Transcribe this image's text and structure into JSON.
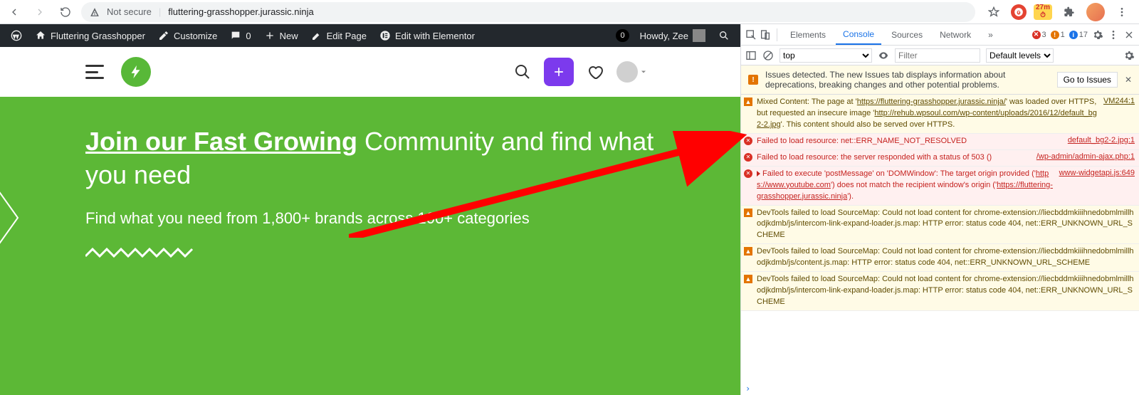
{
  "chrome": {
    "not_secure": "Not secure",
    "url": "fluttering-grasshopper.jurassic.ninja",
    "ext_badge": "27m"
  },
  "wp": {
    "site_name": "Fluttering Grasshopper",
    "customize": "Customize",
    "comments": "0",
    "new": "New",
    "edit_page": "Edit Page",
    "elementor": "Edit with Elementor",
    "notif_count": "0",
    "howdy": "Howdy, Zee"
  },
  "hero": {
    "heading_emph": "Join our Fast Growing",
    "heading_rest": " Community and find what you need",
    "sub": "Find what you need from 1,800+ brands across 100+ categories"
  },
  "devtools": {
    "tabs": {
      "elements": "Elements",
      "console": "Console",
      "sources": "Sources",
      "network": "Network"
    },
    "counts": {
      "errors": "3",
      "warnings": "1",
      "info": "17"
    },
    "context": "top",
    "filter_placeholder": "Filter",
    "levels": "Default levels ▾",
    "issues_text": "Issues detected. The new Issues tab displays information about deprecations, breaking changes and other potential problems.",
    "issues_btn": "Go to Issues",
    "logs": [
      {
        "type": "warn",
        "msg": "Mixed Content: The page at 'https://fluttering-grasshopper.jurassic.ninja/' was loaded over HTTPS, but requested an insecure image 'http://rehub.wpsoul.com/wp-content/uploads/2016/12/default_bg2-2.jpg'. This content should also be served over HTTPS.",
        "src": "VM244:1"
      },
      {
        "type": "err",
        "msg": "Failed to load resource: net::ERR_NAME_NOT_RESOLVED",
        "src": "default_bg2-2.jpg:1"
      },
      {
        "type": "err",
        "msg": "Failed to load resource: the server responded with a status of 503 ()",
        "src": "/wp-admin/admin-ajax.php:1"
      },
      {
        "type": "err",
        "caret": true,
        "msg": "Failed to execute 'postMessage' on 'DOMWindow': The target origin provided ('https://www.youtube.com') does not match the recipient window's origin ('https://fluttering-grasshopper.jurassic.ninja').",
        "src": "www-widgetapi.js:649"
      },
      {
        "type": "warn",
        "msg": "DevTools failed to load SourceMap: Could not load content for chrome-extension://liecbddmkiiihnedobmlmillhodjkdmb/js/intercom-link-expand-loader.js.map: HTTP error: status code 404, net::ERR_UNKNOWN_URL_SCHEME",
        "src": ""
      },
      {
        "type": "warn",
        "msg": "DevTools failed to load SourceMap: Could not load content for chrome-extension://liecbddmkiiihnedobmlmillhodjkdmb/js/content.js.map: HTTP error: status code 404, net::ERR_UNKNOWN_URL_SCHEME",
        "src": ""
      },
      {
        "type": "warn",
        "msg": "DevTools failed to load SourceMap: Could not load content for chrome-extension://liecbddmkiiihnedobmlmillhodjkdmb/js/intercom-link-expand-loader.js.map: HTTP error: status code 404, net::ERR_UNKNOWN_URL_SCHEME",
        "src": ""
      }
    ]
  }
}
